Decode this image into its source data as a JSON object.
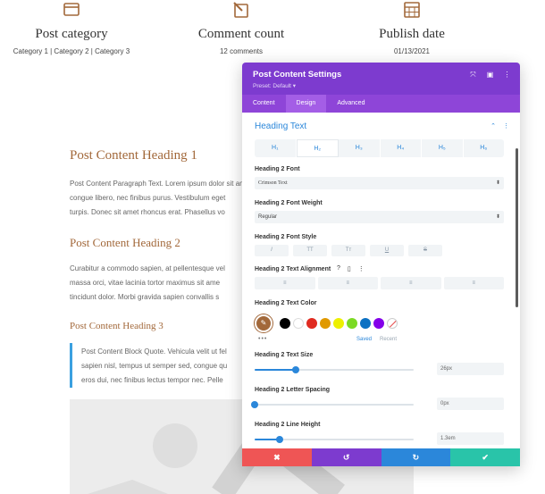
{
  "page": {
    "meta": [
      {
        "title": "Post category",
        "value": "Category 1 | Category 2 | Category 3",
        "icon": "folder-icon"
      },
      {
        "title": "Comment count",
        "value": "12 comments",
        "icon": "pencil-icon"
      },
      {
        "title": "Publish date",
        "value": "01/13/2021",
        "icon": "calendar-icon"
      }
    ],
    "heading1": "Post Content Heading 1",
    "para1": [
      "Post Content Paragraph Text. Lorem ipsum dolor sit amet",
      "congue libero, nec finibus purus. Vestibulum eget",
      "turpis. Donec sit amet rhoncus erat. Phasellus vo"
    ],
    "heading2": "Post Content Heading 2",
    "para2": [
      "Curabitur a commodo sapien, at pellentesque vel",
      "massa orci, vitae lacinia tortor maximus sit ame",
      "tincidunt dolor. Morbi gravida sapien convallis s"
    ],
    "heading3": "Post Content Heading 3",
    "quote": [
      "Post Content Block Quote. Vehicula velit ut fel",
      "sapien nisl, tempus ut semper sed, congue qu",
      "eros dui, nec finibus lectus tempor nec. Pelle"
    ],
    "accent_color": "#a2683a"
  },
  "panel": {
    "title": "Post Content Settings",
    "preset": "Preset: Default ▾",
    "head_icons": [
      "⤧",
      "▣",
      "⋮"
    ],
    "tabs": [
      "Content",
      "Design",
      "Advanced"
    ],
    "active_tab": "Design",
    "section_title": "Heading Text",
    "section_icons": [
      "⌃",
      "⋮"
    ],
    "heading_tabs": [
      "H₁",
      "H₂",
      "H₃",
      "H₄",
      "H₅",
      "H₆"
    ],
    "active_heading": "H₂",
    "font": {
      "label": "Heading 2 Font",
      "value": "Crimson Text"
    },
    "weight": {
      "label": "Heading 2 Font Weight",
      "value": "Regular"
    },
    "style": {
      "label": "Heading 2 Font Style",
      "buttons": [
        "I",
        "TT",
        "Tт",
        "U",
        "S"
      ]
    },
    "alignment": {
      "label": "Heading 2 Text Alignment",
      "icons": [
        "?",
        "▯",
        "⋮"
      ],
      "buttons": [
        "≡",
        "≡",
        "≡",
        "≡"
      ]
    },
    "color": {
      "label": "Heading 2 Text Color",
      "picker_glyph": "✎",
      "swatches": [
        "#000000",
        "#ffffff",
        "#e02b20",
        "#e09900",
        "#edf000",
        "#7cda24",
        "#0c71c3",
        "#8300e9"
      ],
      "more": "•••",
      "saved": "Saved",
      "recent": "Recent"
    },
    "text_size": {
      "label": "Heading 2 Text Size",
      "value": "26px",
      "fraction": 0.26
    },
    "letter_spacing": {
      "label": "Heading 2 Letter Spacing",
      "value": "0px",
      "fraction": 0.0
    },
    "line_height": {
      "label": "Heading 2 Line Height",
      "value": "1.3em",
      "fraction": 0.16
    },
    "footer": [
      "✖",
      "↺",
      "↻",
      "✔"
    ],
    "footer_colors": [
      "#ef5555",
      "#7d3bcf",
      "#2b87da",
      "#29c4a9"
    ],
    "colors": {
      "header": "#7d3bcf",
      "tabs": "#8e45d8",
      "accent": "#2b87da"
    }
  }
}
